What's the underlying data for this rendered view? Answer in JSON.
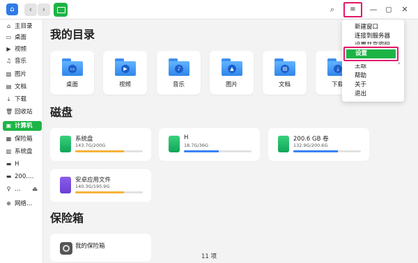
{
  "titlebar": {
    "back": "‹",
    "forward": "›",
    "search": "⌕",
    "menu": "≡",
    "minimize": "—",
    "maximize": "◻",
    "close": "✕"
  },
  "sidebar": {
    "items": [
      {
        "label": "主目录",
        "icon": "⌂"
      },
      {
        "label": "桌面",
        "icon": "▭"
      },
      {
        "label": "视频",
        "icon": "▶"
      },
      {
        "label": "音乐",
        "icon": "♫"
      },
      {
        "label": "图片",
        "icon": "▨"
      },
      {
        "label": "文档",
        "icon": "▤"
      },
      {
        "label": "下载",
        "icon": "⤓"
      },
      {
        "label": "回收站",
        "icon": "🗑"
      },
      {
        "label": "计算机",
        "icon": "▣"
      },
      {
        "label": "保险箱",
        "icon": "▦"
      },
      {
        "label": "系统盘",
        "icon": "▥"
      },
      {
        "label": "H",
        "icon": "▬"
      },
      {
        "label": "200.…",
        "icon": "▬"
      },
      {
        "label": "…",
        "icon": "⚲",
        "eject": "⏏"
      },
      {
        "label": "网络…",
        "icon": "⊕"
      }
    ]
  },
  "main": {
    "my_dirs_title": "我的目录",
    "dirs": [
      {
        "label": "桌面",
        "sym": "▭"
      },
      {
        "label": "视频",
        "sym": "▶"
      },
      {
        "label": "音乐",
        "sym": "♪"
      },
      {
        "label": "图片",
        "sym": "▲"
      },
      {
        "label": "文档",
        "sym": "▤"
      },
      {
        "label": "下载",
        "sym": "⤓"
      }
    ],
    "disks_title": "磁盘",
    "disks": [
      {
        "name": "系统盘",
        "size": "143.7G/200G",
        "usage_fraction": 0.72,
        "color": "#f7b23b"
      },
      {
        "name": "H",
        "size": "18.7G/36G",
        "usage_fraction": 0.52,
        "color": "#3b82f6"
      },
      {
        "name": "200.6 GB 卷",
        "size": "132.9G/200.6G",
        "usage_fraction": 0.66,
        "color": "#3b82f6"
      },
      {
        "name": "安卓应用文件",
        "size": "140.3G/195.9G",
        "usage_fraction": 0.72,
        "color": "#f7b23b"
      }
    ],
    "vault_title": "保险箱",
    "vault": {
      "name": "我的保险箱"
    },
    "footer": "11 项"
  },
  "menu": {
    "items": [
      "新建窗口",
      "连接到服务器",
      "设置共享密码",
      "设置",
      "主题",
      "帮助",
      "关于",
      "退出"
    ]
  },
  "colors": {
    "accent": "#1db446",
    "highlight": "#e5176a"
  }
}
